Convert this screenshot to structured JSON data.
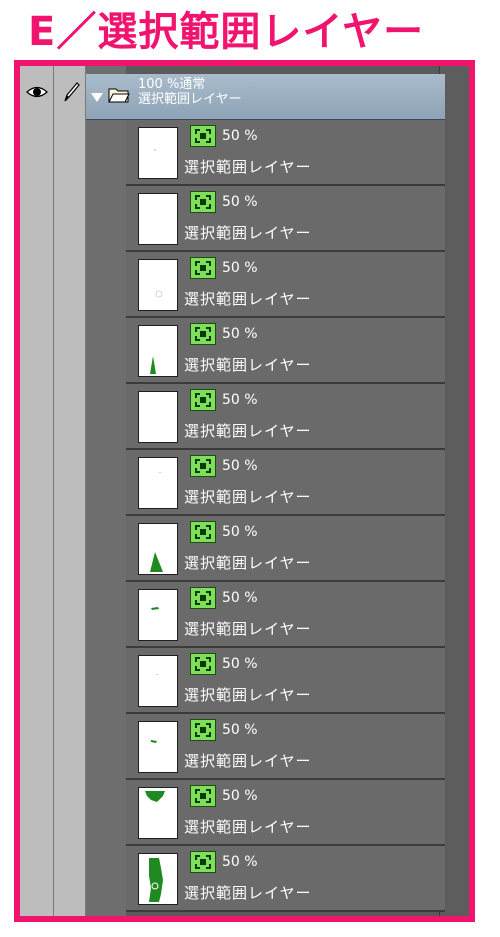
{
  "title": "E／選択範囲レイヤー",
  "folder": {
    "opacity_blend": "100 %通常",
    "name": "選択範囲レイヤー"
  },
  "colors": {
    "title": "#f0146e",
    "frame": "#f0146e",
    "selection_icon": "#7ee05a",
    "thumb_mark": "#1f8a1f"
  },
  "icons": {
    "visibility": "eye-icon",
    "edit": "pen-icon",
    "expand": "triangle-down-icon",
    "folder": "open-folder-icon",
    "layer_type": "selection-layer-icon"
  },
  "layers": [
    {
      "opacity": "50 %",
      "name": "選択範囲レイヤー"
    },
    {
      "opacity": "50 %",
      "name": "選択範囲レイヤー"
    },
    {
      "opacity": "50 %",
      "name": "選択範囲レイヤー"
    },
    {
      "opacity": "50 %",
      "name": "選択範囲レイヤー"
    },
    {
      "opacity": "50 %",
      "name": "選択範囲レイヤー"
    },
    {
      "opacity": "50 %",
      "name": "選択範囲レイヤー"
    },
    {
      "opacity": "50 %",
      "name": "選択範囲レイヤー"
    },
    {
      "opacity": "50 %",
      "name": "選択範囲レイヤー"
    },
    {
      "opacity": "50 %",
      "name": "選択範囲レイヤー"
    },
    {
      "opacity": "50 %",
      "name": "選択範囲レイヤー"
    },
    {
      "opacity": "50 %",
      "name": "選択範囲レイヤー"
    },
    {
      "opacity": "50 %",
      "name": "選択範囲レイヤー"
    }
  ]
}
